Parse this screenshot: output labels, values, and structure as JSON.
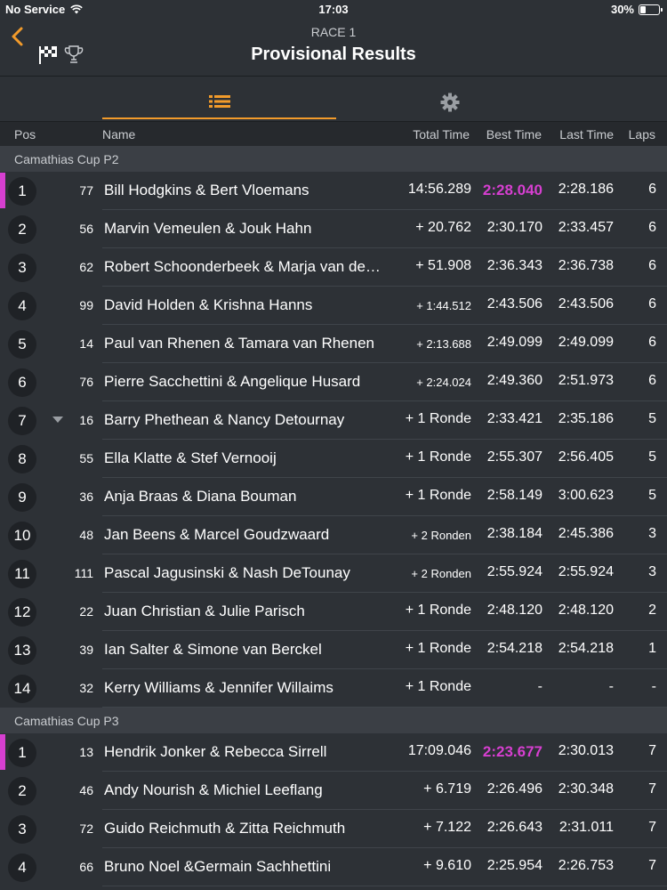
{
  "status": {
    "carrier": "No Service",
    "time": "17:03",
    "battery": "30%",
    "battery_level": 0.3
  },
  "header": {
    "subtitle": "RACE 1",
    "title": "Provisional Results"
  },
  "columns": {
    "pos": "Pos",
    "name": "Name",
    "total": "Total Time",
    "best": "Best Time",
    "last": "Last Time",
    "laps": "Laps"
  },
  "colors": {
    "accent": "#f29b2b",
    "fastest": "#d63fd0"
  },
  "groups": [
    {
      "title": "Camathias Cup P2",
      "rows": [
        {
          "pos": "1",
          "num": "77",
          "name": "Bill Hodgkins & Bert Vloemans",
          "total": "14:56.289",
          "best": "2:28.040",
          "last": "2:28.186",
          "laps": "6",
          "fastest": true
        },
        {
          "pos": "2",
          "num": "56",
          "name": "Marvin Vemeulen & Jouk Hahn",
          "total": "+ 20.762",
          "best": "2:30.170",
          "last": "2:33.457",
          "laps": "6"
        },
        {
          "pos": "3",
          "num": "62",
          "name": "Robert Schoonderbeek & Marja van de…",
          "total": "+ 51.908",
          "best": "2:36.343",
          "last": "2:36.738",
          "laps": "6"
        },
        {
          "pos": "4",
          "num": "99",
          "name": "David Holden & Krishna Hanns",
          "total": "+ 1:44.512",
          "best": "2:43.506",
          "last": "2:43.506",
          "laps": "6",
          "small": true
        },
        {
          "pos": "5",
          "num": "14",
          "name": "Paul van Rhenen & Tamara van Rhenen",
          "total": "+ 2:13.688",
          "best": "2:49.099",
          "last": "2:49.099",
          "laps": "6",
          "small": true
        },
        {
          "pos": "6",
          "num": "76",
          "name": "Pierre Sacchettini & Angelique Husard",
          "total": "+ 2:24.024",
          "best": "2:49.360",
          "last": "2:51.973",
          "laps": "6",
          "small": true
        },
        {
          "pos": "7",
          "num": "16",
          "name": "Barry Phethean & Nancy Detournay",
          "total": "+ 1 Ronde",
          "best": "2:33.421",
          "last": "2:35.186",
          "laps": "5",
          "down": true
        },
        {
          "pos": "8",
          "num": "55",
          "name": "Ella Klatte & Stef Vernooij",
          "total": "+ 1 Ronde",
          "best": "2:55.307",
          "last": "2:56.405",
          "laps": "5"
        },
        {
          "pos": "9",
          "num": "36",
          "name": "Anja Braas & Diana Bouman",
          "total": "+ 1 Ronde",
          "best": "2:58.149",
          "last": "3:00.623",
          "laps": "5"
        },
        {
          "pos": "10",
          "num": "48",
          "name": "Jan Beens & Marcel Goudzwaard",
          "total": "+ 2 Ronden",
          "best": "2:38.184",
          "last": "2:45.386",
          "laps": "3",
          "small": true
        },
        {
          "pos": "11",
          "num": "111",
          "name": "Pascal Jagusinski & Nash DeTounay",
          "total": "+ 2 Ronden",
          "best": "2:55.924",
          "last": "2:55.924",
          "laps": "3",
          "small": true
        },
        {
          "pos": "12",
          "num": "22",
          "name": "Juan Christian & Julie Parisch",
          "total": "+ 1 Ronde",
          "best": "2:48.120",
          "last": "2:48.120",
          "laps": "2"
        },
        {
          "pos": "13",
          "num": "39",
          "name": "Ian Salter & Simone van Berckel",
          "total": "+ 1 Ronde",
          "best": "2:54.218",
          "last": "2:54.218",
          "laps": "1"
        },
        {
          "pos": "14",
          "num": "32",
          "name": "Kerry Williams & Jennifer Willaims",
          "total": "+ 1 Ronde",
          "best": "-",
          "last": "-",
          "laps": "-"
        }
      ]
    },
    {
      "title": "Camathias Cup P3",
      "rows": [
        {
          "pos": "1",
          "num": "13",
          "name": "Hendrik Jonker & Rebecca Sirrell",
          "total": "17:09.046",
          "best": "2:23.677",
          "last": "2:30.013",
          "laps": "7",
          "fastest": true
        },
        {
          "pos": "2",
          "num": "46",
          "name": "Andy Nourish & Michiel Leeflang",
          "total": "+ 6.719",
          "best": "2:26.496",
          "last": "2:30.348",
          "laps": "7"
        },
        {
          "pos": "3",
          "num": "72",
          "name": "Guido Reichmuth & Zitta Reichmuth",
          "total": "+ 7.122",
          "best": "2:26.643",
          "last": "2:31.011",
          "laps": "7"
        },
        {
          "pos": "4",
          "num": "66",
          "name": "Bruno Noel &Germain Sachhettini",
          "total": "+ 9.610",
          "best": "2:25.954",
          "last": "2:26.753",
          "laps": "7"
        }
      ]
    }
  ]
}
